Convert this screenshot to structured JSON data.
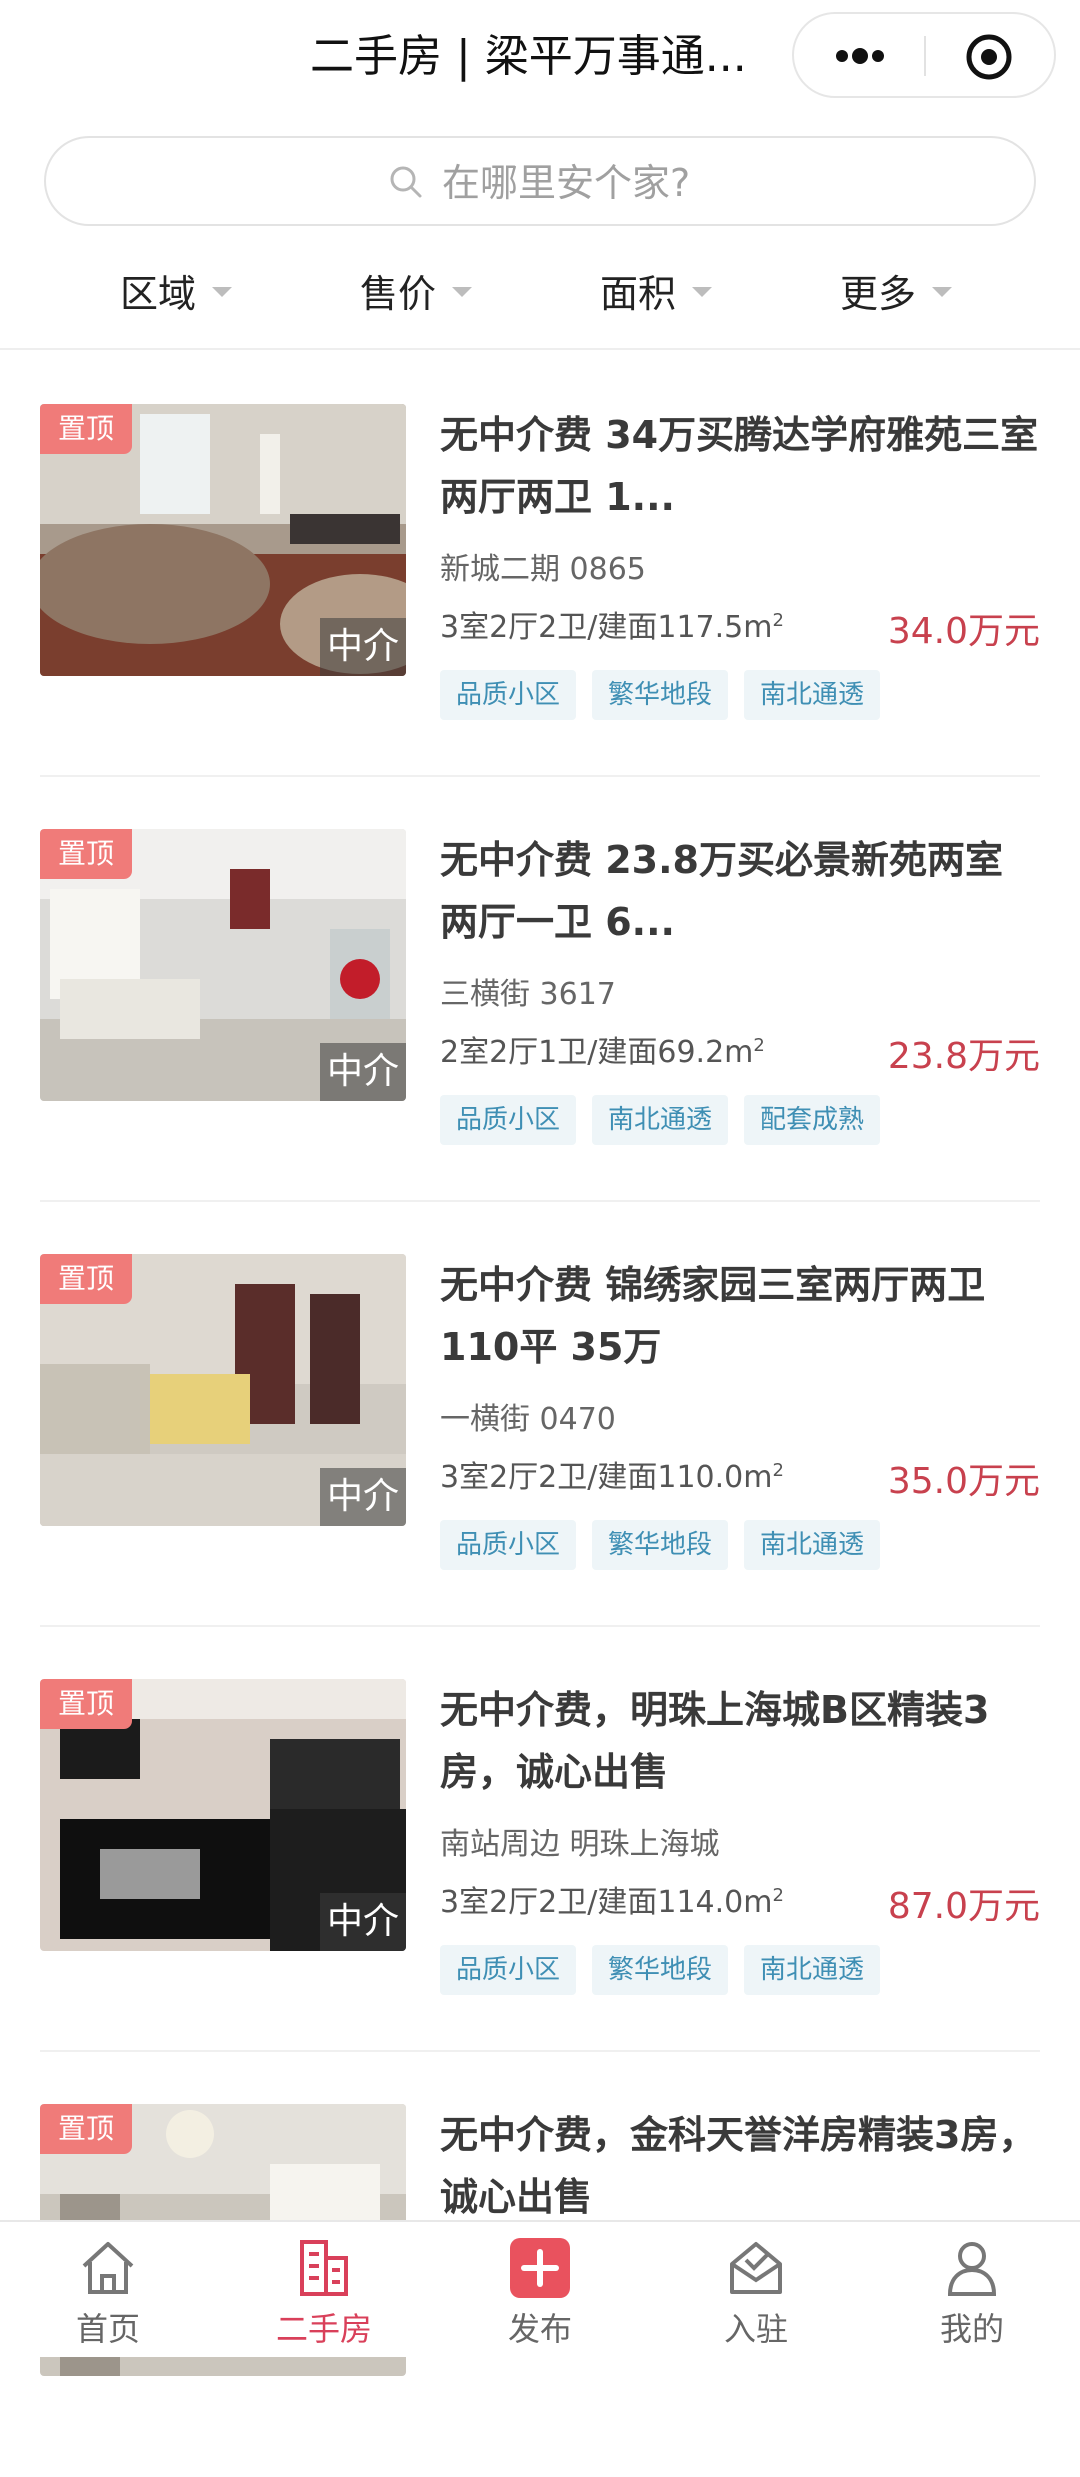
{
  "navbar": {
    "title": "二手房 | 梁平万事通..."
  },
  "search": {
    "placeholder": "在哪里安个家?"
  },
  "filters": [
    "区域",
    "售价",
    "面积",
    "更多"
  ],
  "listings": [
    {
      "badge": "置顶",
      "agent": "中介",
      "title": "无中介费 34万买腾达学府雅苑三室两厅两卫 1...",
      "community": "新城二期 0865",
      "spec": "3室2厅2卫/建面117.5m",
      "spec_sup": "2",
      "price": "34.0万元",
      "tags": [
        "品质小区",
        "繁华地段",
        "南北通透"
      ]
    },
    {
      "badge": "置顶",
      "agent": "中介",
      "title": "无中介费 23.8万买必景新苑两室两厅一卫 6...",
      "community": "三横街 3617",
      "spec": "2室2厅1卫/建面69.2m",
      "spec_sup": "2",
      "price": "23.8万元",
      "tags": [
        "品质小区",
        "南北通透",
        "配套成熟"
      ]
    },
    {
      "badge": "置顶",
      "agent": "中介",
      "title": "无中介费 锦绣家园三室两厅两卫 110平 35万",
      "community": "一横街 0470",
      "spec": "3室2厅2卫/建面110.0m",
      "spec_sup": "2",
      "price": "35.0万元",
      "tags": [
        "品质小区",
        "繁华地段",
        "南北通透"
      ]
    },
    {
      "badge": "置顶",
      "agent": "中介",
      "title": "无中介费，明珠上海城B区精装3房，诚心出售",
      "community": "南站周边 明珠上海城",
      "spec": "3室2厅2卫/建面114.0m",
      "spec_sup": "2",
      "price": "87.0万元",
      "tags": [
        "品质小区",
        "繁华地段",
        "南北通透"
      ]
    },
    {
      "badge": "置顶",
      "agent": "",
      "title": "无中介费，金科天誉洋房精装3房，诚心出售",
      "community": "",
      "spec": "",
      "spec_sup": "",
      "price": "",
      "tags": []
    }
  ],
  "tabbar": [
    {
      "label": "首页",
      "icon": "home-icon",
      "active": false
    },
    {
      "label": "二手房",
      "icon": "building-icon",
      "active": true
    },
    {
      "label": "发布",
      "icon": "plus-icon",
      "active": false
    },
    {
      "label": "入驻",
      "icon": "inbox-check-icon",
      "active": false
    },
    {
      "label": "我的",
      "icon": "user-icon",
      "active": false
    }
  ],
  "colors": {
    "accent": "#d9405a",
    "price": "#c8414e",
    "badge": "#f07b79",
    "tag_text": "#3f8fb4",
    "tag_bg": "#eef5f8"
  }
}
